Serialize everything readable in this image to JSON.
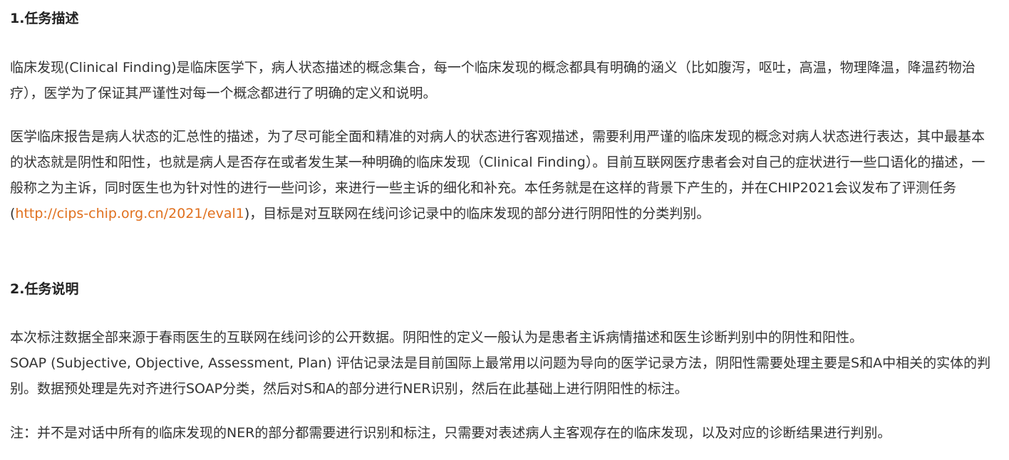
{
  "section1": {
    "heading": "1.任务描述",
    "para1": "临床发现(Clinical Finding)是临床医学下，病人状态描述的概念集合，每一个临床发现的概念都具有明确的涵义（比如腹泻，呕吐，高温，物理降温，降温药物治疗），医学为了保证其严谨性对每一个概念都进行了明确的定义和说明。",
    "para2_before_link": "医学临床报告是病人状态的汇总性的描述，为了尽可能全面和精准的对病人的状态进行客观描述，需要利用严谨的临床发现的概念对病人状态进行表达，其中最基本的状态就是阴性和阳性，也就是病人是否存在或者发生某一种明确的临床发现（Clinical Finding）。目前互联网医疗患者会对自己的症状进行一些口语化的描述，一般称之为主诉，同时医生也为针对性的进行一些问诊，来进行一些主诉的细化和补充。本任务就是在这样的背景下产生的，并在CHIP2021会议发布了评测任务(",
    "para2_link": "http://cips-chip.org.cn/2021/eval1",
    "para2_after_link": ")，目标是对互联网在线问诊记录中的临床发现的部分进行阴阳性的分类判别。"
  },
  "section2": {
    "heading": "2.任务说明",
    "para1_line1": "本次标注数据全部来源于春雨医生的互联网在线问诊的公开数据。阴阳性的定义一般认为是患者主诉病情描述和医生诊断判别中的阴性和阳性。",
    "para1_line2": "SOAP (Subjective, Objective, Assessment, Plan) 评估记录法是目前国际上最常用以问题为导向的医学记录方法，阴阳性需要处理主要是S和A中相关的实体的判别。数据预处理是先对齐进行SOAP分类，然后对S和A的部分进行NER识别，然后在此基础上进行阴阳性的标注。",
    "note": "注：并不是对话中所有的临床发现的NER的部分都需要进行识别和标注，只需要对表述病人主客观存在的临床发现，以及对应的诊断结果进行判别。"
  },
  "colors": {
    "text": "#333333",
    "heading": "#222222",
    "link": "#e0701e"
  }
}
